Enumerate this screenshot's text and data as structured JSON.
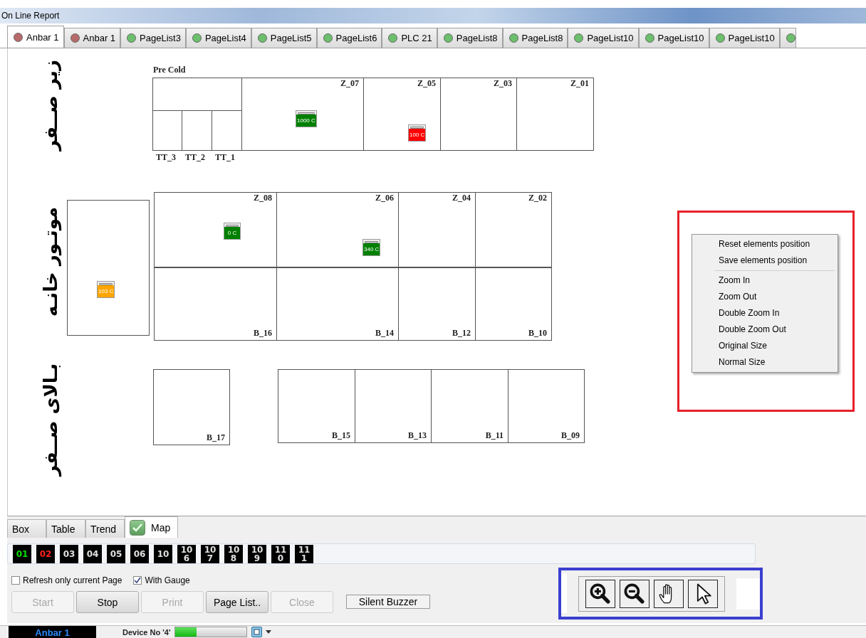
{
  "window": {
    "title": "On Line Report"
  },
  "tabs": [
    {
      "label": "Anbar 1",
      "selected": true,
      "color": "#b86a6a"
    },
    {
      "label": "Anbar 1",
      "selected": false,
      "color": "#b86a6a"
    },
    {
      "label": "PageList3",
      "selected": false,
      "color": "#6cbf6c"
    },
    {
      "label": "PageList4",
      "selected": false,
      "color": "#6cbf6c"
    },
    {
      "label": "PageList5",
      "selected": false,
      "color": "#6cbf6c"
    },
    {
      "label": "PageList6",
      "selected": false,
      "color": "#6cbf6c"
    },
    {
      "label": "PLC 21",
      "selected": false,
      "color": "#6cbf6c"
    },
    {
      "label": "PageList8",
      "selected": false,
      "color": "#6cbf6c"
    },
    {
      "label": "PageList8",
      "selected": false,
      "color": "#6cbf6c"
    },
    {
      "label": "PageList10",
      "selected": false,
      "color": "#6cbf6c"
    },
    {
      "label": "PageList10",
      "selected": false,
      "color": "#6cbf6c"
    },
    {
      "label": "PageList10",
      "selected": false,
      "color": "#6cbf6c"
    }
  ],
  "map": {
    "area_labels": [
      "زیر صــفر",
      "موتـور خانـه",
      "بـالای صــفر"
    ],
    "pre_cold": {
      "title": "Pre Cold",
      "rooms": [
        "TT_3",
        "TT_2",
        "TT_1"
      ]
    },
    "zones": [
      "Z_07",
      "Z_05",
      "Z_03",
      "Z_01",
      "Z_08",
      "Z_06",
      "Z_04",
      "Z_02",
      "B_16",
      "B_14",
      "B_12",
      "B_10",
      "B_17",
      "B_15",
      "B_13",
      "B_11",
      "B_09"
    ],
    "gauges": [
      {
        "value": "1000 C",
        "color": "#008000"
      },
      {
        "value": "100 C",
        "color": "#ff0000"
      },
      {
        "value": "0 C",
        "color": "#008000"
      },
      {
        "value": "340 C",
        "color": "#008000"
      },
      {
        "value": "103 C",
        "color": "#ffa500"
      }
    ]
  },
  "context_menu": {
    "groups": [
      [
        "Reset elements position",
        "Save elements position"
      ],
      [
        "Zoom In",
        "Zoom Out",
        "Double Zoom In",
        "Double Zoom Out",
        "Original Size",
        "Normal Size"
      ]
    ]
  },
  "view_tabs": [
    {
      "label": "Box",
      "selected": false,
      "checked": false
    },
    {
      "label": "Table",
      "selected": false,
      "checked": false
    },
    {
      "label": "Trend",
      "selected": false,
      "checked": false
    },
    {
      "label": "Map",
      "selected": true,
      "checked": true
    }
  ],
  "devices": [
    {
      "label": "01",
      "online": true,
      "alarm": false
    },
    {
      "label": "02",
      "online": false,
      "alarm": true
    },
    {
      "label": "03",
      "online": false,
      "alarm": false
    },
    {
      "label": "04",
      "online": false,
      "alarm": false
    },
    {
      "label": "05",
      "online": false,
      "alarm": false
    },
    {
      "label": "06",
      "online": false,
      "alarm": false
    },
    {
      "label": "10",
      "online": false,
      "alarm": false
    },
    {
      "label": "106",
      "online": false,
      "alarm": false
    },
    {
      "label": "107",
      "online": false,
      "alarm": false
    },
    {
      "label": "108",
      "online": false,
      "alarm": false
    },
    {
      "label": "109",
      "online": false,
      "alarm": false
    },
    {
      "label": "110",
      "online": false,
      "alarm": false
    },
    {
      "label": "111",
      "online": false,
      "alarm": false
    }
  ],
  "options": [
    {
      "label": "Refresh only current Page",
      "checked": false
    },
    {
      "label": "With Gauge",
      "checked": true
    }
  ],
  "buttons": [
    {
      "label": "Start",
      "disabled": true
    },
    {
      "label": "Stop",
      "disabled": false
    },
    {
      "label": "Print",
      "disabled": true
    },
    {
      "label": "Page List..",
      "disabled": false
    },
    {
      "label": "Close",
      "disabled": true
    }
  ],
  "buzzer_button": "Silent Buzzer",
  "status_bar": {
    "page": "Anbar 1",
    "device": "Device No '4'",
    "level": 0.3
  }
}
